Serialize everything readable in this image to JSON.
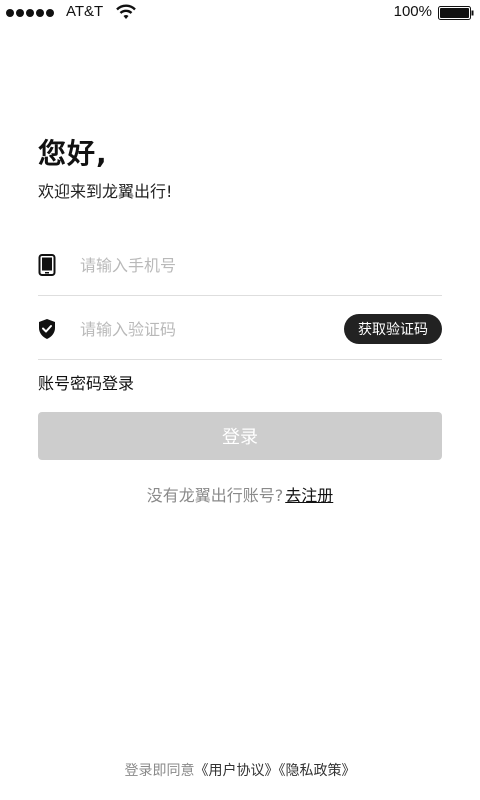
{
  "status_bar": {
    "carrier": "AT&T",
    "battery_percent": "100%",
    "battery_level": 1.0,
    "signal_bars": 5
  },
  "greeting": {
    "title": "您好,",
    "subtitle": "欢迎来到龙翼出行!"
  },
  "phone_field": {
    "icon": "phone-icon",
    "placeholder": "请输入手机号",
    "value": ""
  },
  "code_field": {
    "icon": "shield-check-icon",
    "placeholder": "请输入验证码",
    "value": "",
    "get_code_label": "获取验证码"
  },
  "password_login_label": "账号密码登录",
  "login_button_label": "登录",
  "register": {
    "prompt": "没有龙翼出行账号?",
    "link": "去注册"
  },
  "agreement": {
    "prefix": "登录即同意",
    "user_agreement": "《用户协议》",
    "privacy_policy": "《隐私政策》"
  },
  "colors": {
    "primary_dark": "#222222",
    "disabled_button": "#cdcdcd",
    "muted_text": "#8a8a8a"
  }
}
